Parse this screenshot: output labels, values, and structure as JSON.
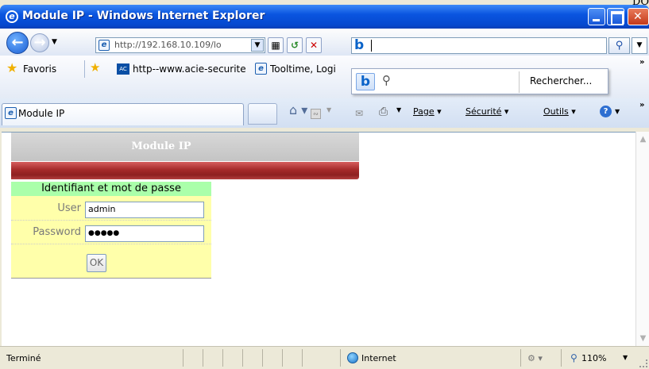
{
  "corner_text": "DO",
  "window": {
    "title": "Module IP - Windows Internet Explorer",
    "icon": "ie-icon"
  },
  "address_bar": {
    "url": "http://192.168.10.109/lo",
    "back_icon": "back-arrow-icon",
    "forward_icon": "forward-arrow-icon"
  },
  "search": {
    "value": "",
    "provider_icon": "bing-icon",
    "suggestion_label": "Rechercher..."
  },
  "favorites_bar": {
    "label": "Favoris",
    "links": [
      "http--www.acie-securite",
      "Tooltime, Logi"
    ]
  },
  "tab": {
    "title": "Module IP"
  },
  "command_bar": {
    "page": "Page",
    "security": "Sécurité",
    "tools": "Outils"
  },
  "page": {
    "header_title": "Module IP",
    "login": {
      "heading": "Identifiant et mot de passe",
      "user_label": "User",
      "user_value": "admin",
      "password_label": "Password",
      "password_value": "●●●●●",
      "ok_label": "OK"
    },
    "colors": {
      "header_gray": "#c8c8c8",
      "bar_red": "#a52a2a",
      "login_bg": "#ffffaa",
      "login_head_bg": "#aaffaa"
    }
  },
  "status_bar": {
    "status": "Terminé",
    "zone": "Internet",
    "zoom": "110%"
  }
}
